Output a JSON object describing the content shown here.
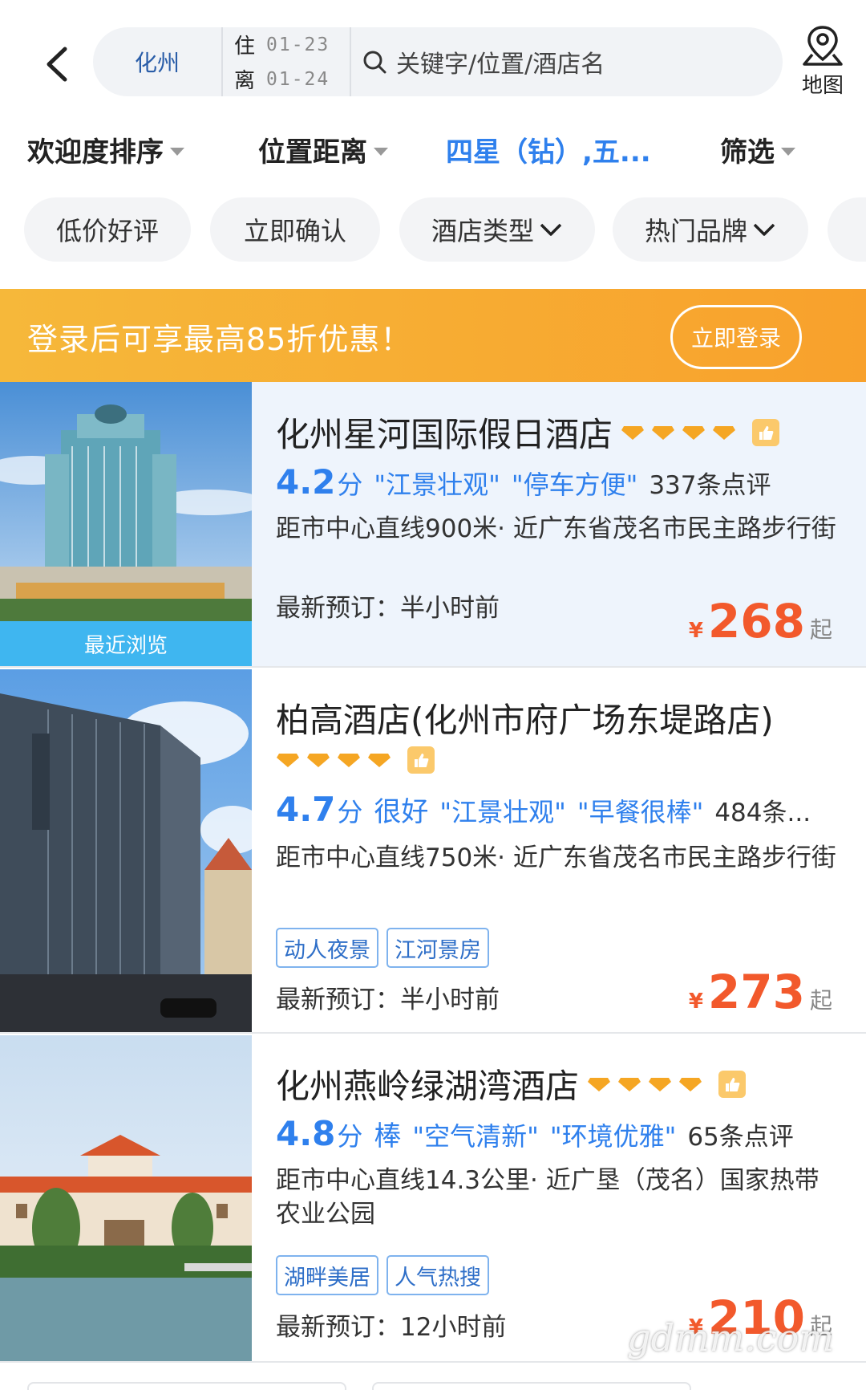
{
  "header": {
    "city": "化州",
    "checkin_label": "住",
    "checkin_date": "01-23",
    "checkout_label": "离",
    "checkout_date": "01-24",
    "search_placeholder": "关键字/位置/酒店名",
    "map_label": "地图"
  },
  "sort": {
    "items": [
      {
        "label": "欢迎度排序"
      },
      {
        "label": "位置距离"
      },
      {
        "label": "四星（钻）,五..."
      },
      {
        "label": "筛选"
      }
    ]
  },
  "chips": [
    "低价好评",
    "立即确认",
    "酒店类型",
    "热门品牌"
  ],
  "banner": {
    "text": "登录后可享最高85折优惠！",
    "button": "立即登录"
  },
  "hotels": [
    {
      "name": "化州星河国际假日酒店",
      "score": "4.2",
      "score_unit": "分",
      "word": "",
      "tags": [
        "\"江景壮观\"",
        "\"停车方便\""
      ],
      "reviews": "337条点评",
      "distance": "距市中心直线900米· 近广东省茂名市民主路步行街",
      "badges": [],
      "latest": "最新预订：半小时前",
      "currency": "¥",
      "price": "268",
      "price_suffix": "起",
      "photo_tag": "最近浏览"
    },
    {
      "name": "柏高酒店(化州市府广场东堤路店)",
      "score": "4.7",
      "score_unit": "分",
      "word": "很好",
      "tags": [
        "\"江景壮观\"",
        "\"早餐很棒\""
      ],
      "reviews": "484条...",
      "distance": "距市中心直线750米· 近广东省茂名市民主路步行街",
      "badges": [
        "动人夜景",
        "江河景房"
      ],
      "latest": "最新预订：半小时前",
      "currency": "¥",
      "price": "273",
      "price_suffix": "起"
    },
    {
      "name": "化州燕岭绿湖湾酒店",
      "score": "4.8",
      "score_unit": "分",
      "word": "棒",
      "tags": [
        "\"空气清新\"",
        "\"环境优雅\""
      ],
      "reviews": "65条点评",
      "distance": "距市中心直线14.3公里· 近广垦（茂名）国家热带农业公园",
      "badges": [
        "湖畔美居",
        "人气热搜"
      ],
      "latest": "最新预订：12小时前",
      "currency": "¥",
      "price": "210",
      "price_suffix": "起"
    }
  ],
  "watermark": "gdmm.com",
  "colors": {
    "accent_blue": "#2f80ed",
    "price_orange": "#f2592c",
    "banner_orange": "#f8a12c",
    "diamond_gold": "#f5a623"
  }
}
